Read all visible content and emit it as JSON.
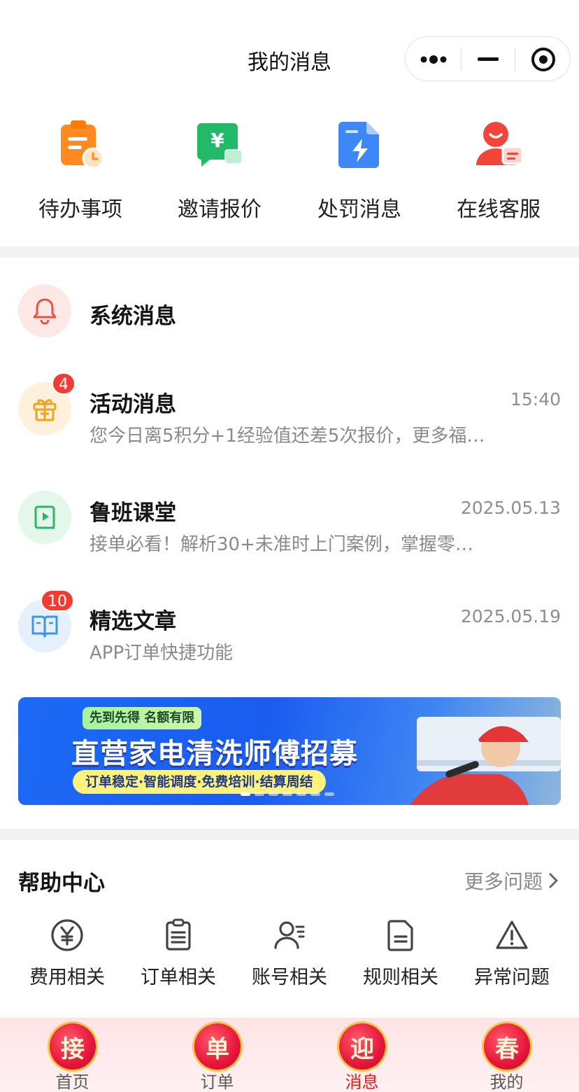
{
  "header": {
    "title": "我的消息"
  },
  "quick_entries": [
    {
      "label": "待办事项",
      "icon": "clipboard-clock-icon"
    },
    {
      "label": "邀请报价",
      "icon": "yen-chat-icon"
    },
    {
      "label": "处罚消息",
      "icon": "document-bolt-icon"
    },
    {
      "label": "在线客服",
      "icon": "customer-service-icon"
    }
  ],
  "messages": [
    {
      "title": "系统消息",
      "time": "",
      "preview": "",
      "badge": "",
      "icon": "bell-icon"
    },
    {
      "title": "活动消息",
      "time": "15:40",
      "preview": "您今日离5积分+1经验值还差5次报价，更多福…",
      "badge": "4",
      "icon": "gift-icon"
    },
    {
      "title": "鲁班课堂",
      "time": "2025.05.13",
      "preview": "接单必看！解析30+未准时上门案例，掌握零…",
      "badge": "",
      "icon": "video-book-icon"
    },
    {
      "title": "精选文章",
      "time": "2025.05.19",
      "preview": "APP订单快捷功能",
      "badge": "10",
      "icon": "open-book-icon"
    }
  ],
  "banner": {
    "tag": "先到先得 名额有限",
    "title": "直营家电清洗师傅招募",
    "subtitle": "订单稳定·智能调度·免费培训·结算周结",
    "dots_total": 7,
    "active_dot": 0
  },
  "help": {
    "title": "帮助中心",
    "more": "更多问题",
    "items": [
      {
        "label": "费用相关",
        "icon": "yen-circle-icon"
      },
      {
        "label": "订单相关",
        "icon": "clipboard-list-icon"
      },
      {
        "label": "账号相关",
        "icon": "user-list-icon"
      },
      {
        "label": "规则相关",
        "icon": "document-icon"
      },
      {
        "label": "异常问题",
        "icon": "warning-icon"
      }
    ]
  },
  "tabbar": {
    "tabs": [
      {
        "label": "首页",
        "glyph": "接",
        "active": false
      },
      {
        "label": "订单",
        "glyph": "单",
        "active": false
      },
      {
        "label": "消息",
        "glyph": "迎",
        "active": true
      },
      {
        "label": "我的",
        "glyph": "春",
        "active": false
      }
    ]
  },
  "colors": {
    "badge": "#f23b33",
    "active_tab": "#f01a1a",
    "banner_blue": "#1d6af5"
  }
}
